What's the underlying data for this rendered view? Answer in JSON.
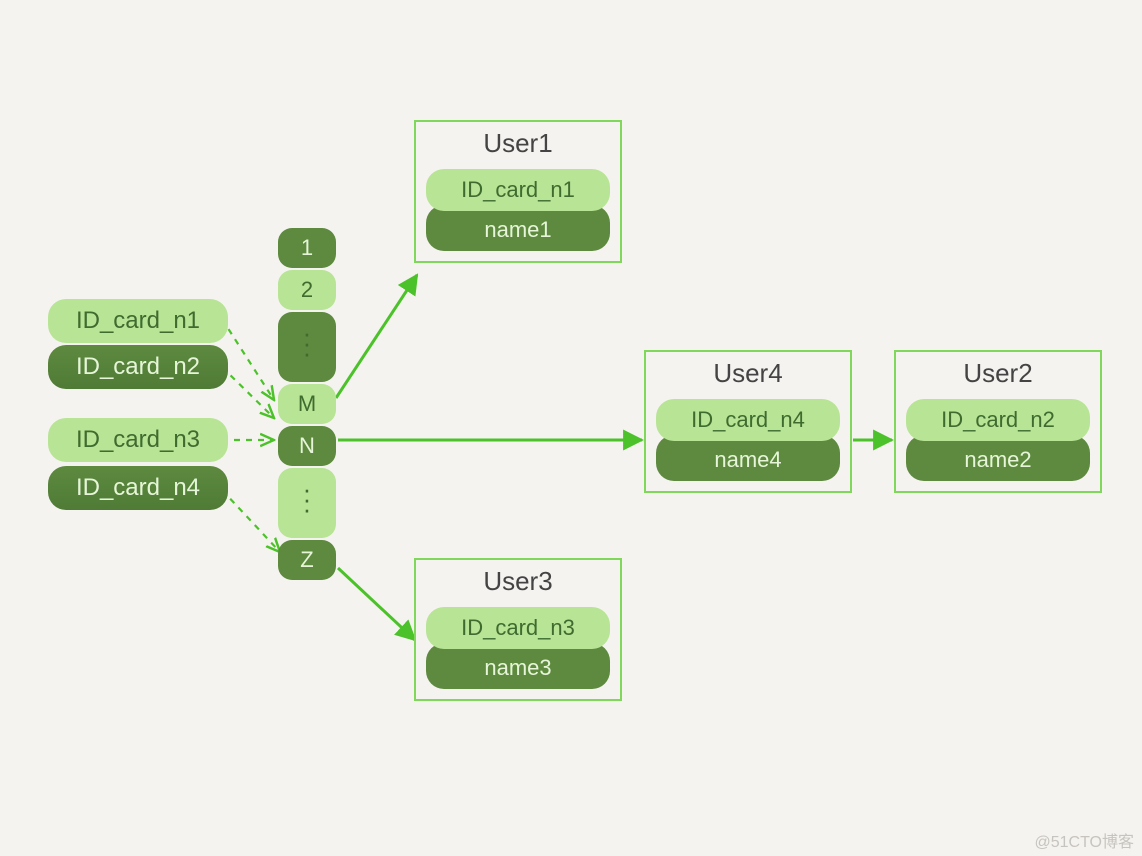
{
  "id_cards": {
    "c1": "ID_card_n1",
    "c2": "ID_card_n2",
    "c3": "ID_card_n3",
    "c4": "ID_card_n4"
  },
  "hash_slots": {
    "s1": "1",
    "s2": "2",
    "sM": "M",
    "sN": "N",
    "sZ": "Z"
  },
  "users": {
    "u1": {
      "title": "User1",
      "id": "ID_card_n1",
      "name": "name1"
    },
    "u2": {
      "title": "User2",
      "id": "ID_card_n2",
      "name": "name2"
    },
    "u3": {
      "title": "User3",
      "id": "ID_card_n3",
      "name": "name3"
    },
    "u4": {
      "title": "User4",
      "id": "ID_card_n4",
      "name": "name4"
    }
  },
  "watermark": "@51CTO博客"
}
